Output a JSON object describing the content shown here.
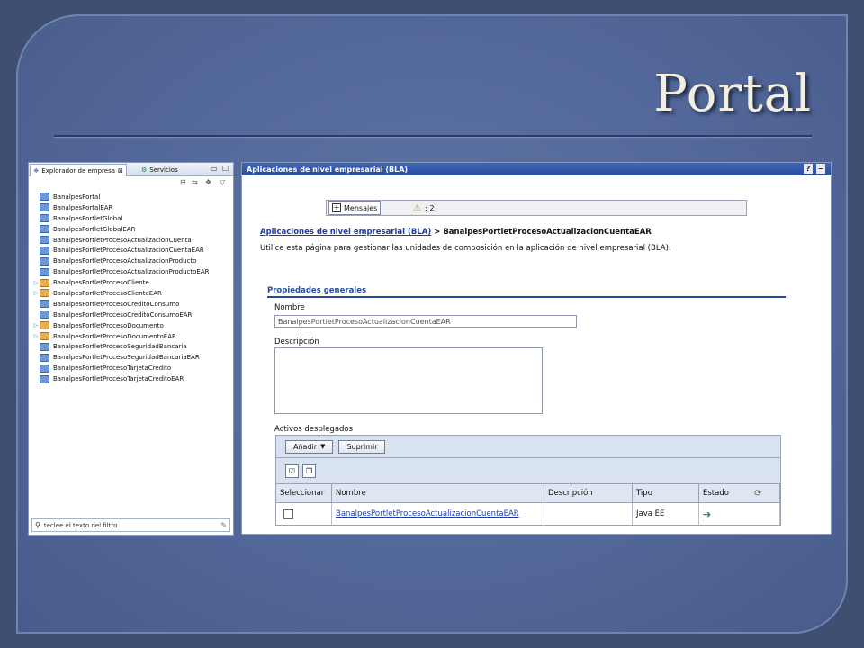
{
  "slide": {
    "title": "Portal"
  },
  "explorer": {
    "tab_active": "Explorador de empresa",
    "tab_second": "Servicios",
    "items": [
      {
        "label": "BanalpesPortal",
        "expandable": false
      },
      {
        "label": "BanalpesPortalEAR",
        "expandable": false
      },
      {
        "label": "BanalpesPortletGlobal",
        "expandable": false
      },
      {
        "label": "BanalpesPortletGlobalEAR",
        "expandable": false
      },
      {
        "label": "BanalpesPortletProcesoActualizacionCuenta",
        "expandable": false
      },
      {
        "label": "BanalpesPortletProcesoActualizacionCuentaEAR",
        "expandable": false
      },
      {
        "label": "BanalpesPortletProcesoActualizacionProducto",
        "expandable": false
      },
      {
        "label": "BanalpesPortletProcesoActualizacionProductoEAR",
        "expandable": false
      },
      {
        "label": "BanalpesPortletProcesoCliente",
        "expandable": true
      },
      {
        "label": "BanalpesPortletProcesoClienteEAR",
        "expandable": true
      },
      {
        "label": "BanalpesPortletProcesoCreditoConsumo",
        "expandable": false
      },
      {
        "label": "BanalpesPortletProcesoCreditoConsumoEAR",
        "expandable": false
      },
      {
        "label": "BanalpesPortletProcesoDocumento",
        "expandable": true
      },
      {
        "label": "BanalpesPortletProcesoDocumentoEAR",
        "expandable": true
      },
      {
        "label": "BanalpesPortletProcesoSeguridadBancaria",
        "expandable": false
      },
      {
        "label": "BanalpesPortletProcesoSeguridadBancariaEAR",
        "expandable": false
      },
      {
        "label": "BanalpesPortletProcesoTarjetaCredito",
        "expandable": false
      },
      {
        "label": "BanalpesPortletProcesoTarjetaCreditoEAR",
        "expandable": false
      }
    ],
    "filter_placeholder": "teclee el texto del filtro"
  },
  "panel": {
    "header": "Aplicaciones de nivel empresarial (BLA)",
    "help": "?",
    "messages_label": "Mensajes",
    "messages_count": ": 2",
    "breadcrumb_link": "Aplicaciones de nivel empresarial (BLA)",
    "breadcrumb_current": "> BanalpesPortletProcesoActualizacionCuentaEAR",
    "description": "Utilice esta página para gestionar las unidades de composición en la aplicación de nivel empresarial (BLA).",
    "section_title": "Propiedades generales",
    "name_label": "Nombre",
    "name_value": "BanalpesPortletProcesoActualizacionCuentaEAR",
    "desc_label": "Descripción",
    "assets_label": "Activos desplegados",
    "add_button": "Añadir",
    "delete_button": "Suprimir",
    "columns": [
      "Seleccionar",
      "Nombre",
      "Descripción",
      "Tipo",
      "Estado"
    ],
    "rows": [
      {
        "name": "BanalpesPortletProcesoActualizacionCuentaEAR",
        "description": "",
        "type": "Java EE"
      }
    ]
  }
}
